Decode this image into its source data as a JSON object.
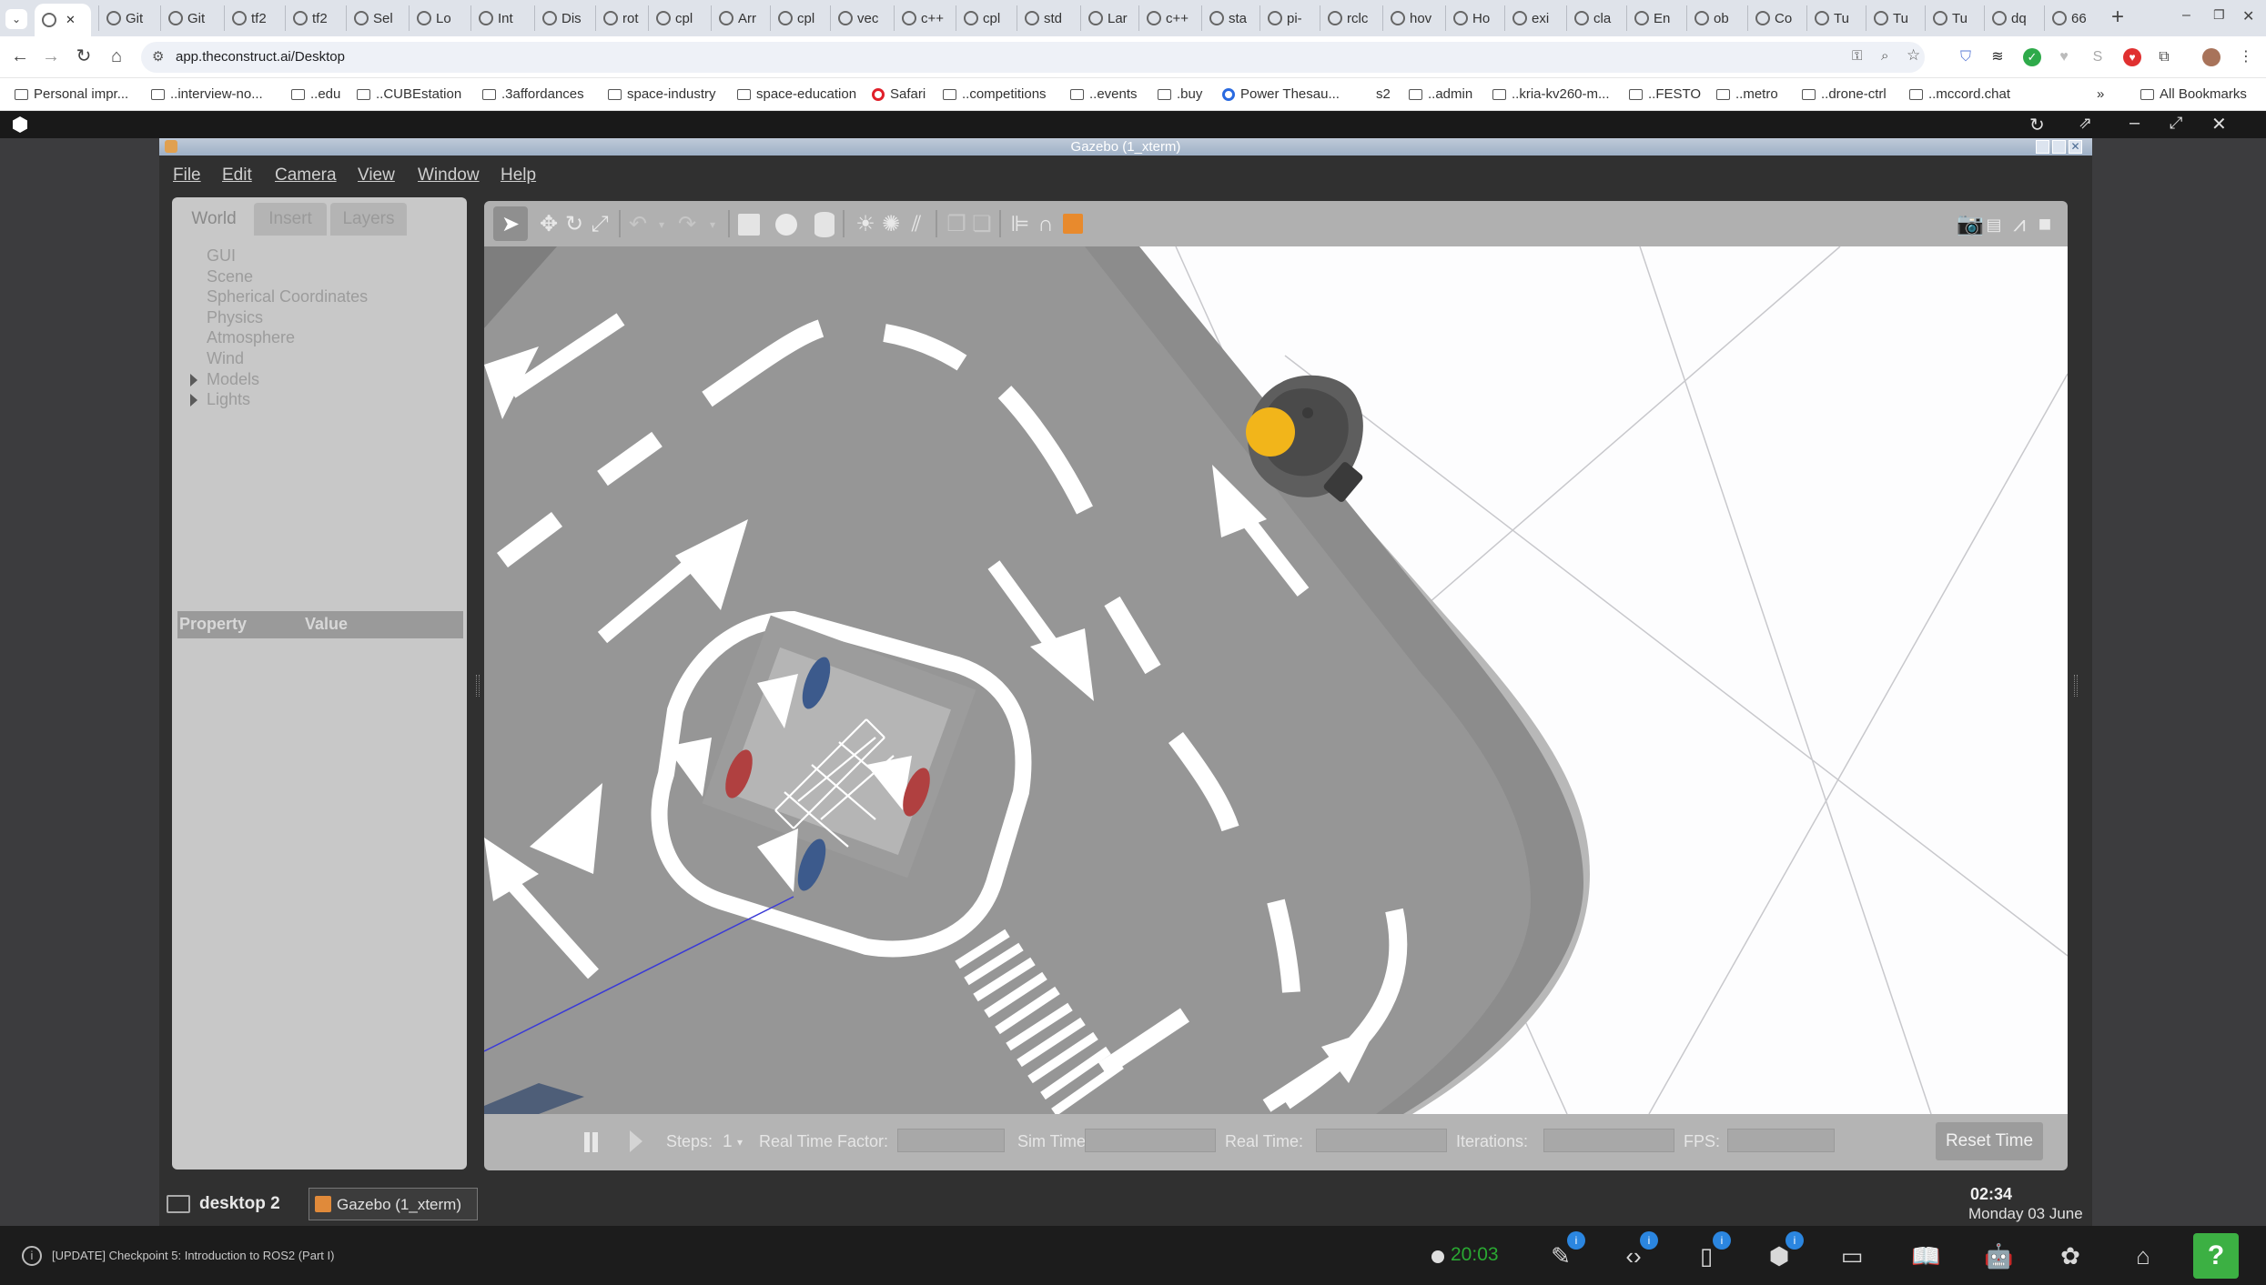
{
  "browser": {
    "tabs": [
      {
        "label": ""
      },
      {
        "label": "Git"
      },
      {
        "label": "Git"
      },
      {
        "label": "tf2"
      },
      {
        "label": "tf2"
      },
      {
        "label": "Sel"
      },
      {
        "label": "Lo"
      },
      {
        "label": "Int"
      },
      {
        "label": "Dis"
      },
      {
        "label": "rot"
      },
      {
        "label": "cpl"
      },
      {
        "label": "Arr"
      },
      {
        "label": "cpl"
      },
      {
        "label": "vec"
      },
      {
        "label": "c++"
      },
      {
        "label": "cpl"
      },
      {
        "label": "std"
      },
      {
        "label": "Lar"
      },
      {
        "label": "c++"
      },
      {
        "label": "sta"
      },
      {
        "label": "pi-"
      },
      {
        "label": "rclc"
      },
      {
        "label": "hov"
      },
      {
        "label": "Ho"
      },
      {
        "label": "exi"
      },
      {
        "label": "cla"
      },
      {
        "label": "En"
      },
      {
        "label": "ob"
      },
      {
        "label": "Co"
      },
      {
        "label": "Tu"
      },
      {
        "label": "Tu"
      },
      {
        "label": "Tu"
      },
      {
        "label": "dq"
      },
      {
        "label": "66"
      }
    ],
    "new_tab": "+",
    "window_controls": {
      "minimize": "–",
      "restore": "❐",
      "close": "✕"
    },
    "url": "app.theconstruct.ai/Desktop",
    "bookmarks": [
      {
        "label": "Personal impr...",
        "icon": "folder-icon"
      },
      {
        "label": "..interview-no...",
        "icon": "folder-icon"
      },
      {
        "label": "..edu",
        "icon": "folder-icon"
      },
      {
        "label": "..CUBEstation",
        "icon": "folder-icon"
      },
      {
        "label": ".3affordances",
        "icon": "folder-icon"
      },
      {
        "label": "space-industry",
        "icon": "folder-icon"
      },
      {
        "label": "space-education",
        "icon": "folder-icon"
      },
      {
        "label": "Safari",
        "icon": "opera-icon"
      },
      {
        "label": "..competitions",
        "icon": "folder-icon"
      },
      {
        "label": "..events",
        "icon": "folder-icon"
      },
      {
        "label": ".buy",
        "icon": "folder-icon"
      },
      {
        "label": "Power Thesau...",
        "icon": "power-thesaurus-icon"
      },
      {
        "label": "s2",
        "icon": "none"
      },
      {
        "label": "..admin",
        "icon": "folder-icon"
      },
      {
        "label": "..kria-kv260-m...",
        "icon": "folder-icon"
      },
      {
        "label": "..FESTO",
        "icon": "folder-icon"
      },
      {
        "label": "..metro",
        "icon": "folder-icon"
      },
      {
        "label": "..drone-ctrl",
        "icon": "folder-icon"
      },
      {
        "label": "..mccord.chat",
        "icon": "folder-icon"
      }
    ],
    "overflow": "»",
    "all_bookmarks": "All Bookmarks"
  },
  "gazebo": {
    "window_title": "Gazebo (1_xterm)",
    "menu": [
      "File",
      "Edit",
      "Camera",
      "View",
      "Window",
      "Help"
    ],
    "panel_tabs": [
      "World",
      "Insert",
      "Layers"
    ],
    "tree": [
      {
        "label": "GUI",
        "expandable": false
      },
      {
        "label": "Scene",
        "expandable": false
      },
      {
        "label": "Spherical Coordinates",
        "expandable": false
      },
      {
        "label": "Physics",
        "expandable": false
      },
      {
        "label": "Atmosphere",
        "expandable": false
      },
      {
        "label": "Wind",
        "expandable": false
      },
      {
        "label": "Models",
        "expandable": true
      },
      {
        "label": "Lights",
        "expandable": true
      }
    ],
    "property_header": {
      "property": "Property",
      "value": "Value"
    },
    "bottom": {
      "steps_label": "Steps:",
      "steps_value": "1",
      "rtf_label": "Real Time Factor:",
      "sim_time_label": "Sim Time:",
      "real_time_label": "Real Time:",
      "iterations_label": "Iterations:",
      "fps_label": "FPS:",
      "reset_button": "Reset Time"
    }
  },
  "desktop_taskbar": {
    "desktop_label": "desktop 2",
    "task_label": "Gazebo (1_xterm)",
    "time": "02:34",
    "date": "Monday 03 June"
  },
  "construct_bar": {
    "status_text": "[UPDATE] Checkpoint 5: Introduction to ROS2 (Part I)",
    "timer": "20:03",
    "badges": [
      "i",
      "i",
      "i",
      "i"
    ],
    "help": "?"
  },
  "colors": {
    "accent_green": "#3cb043",
    "badge_blue": "#2b86e0",
    "robot_yellow": "#f2b51a",
    "road_gray": "#8c8c8c"
  }
}
